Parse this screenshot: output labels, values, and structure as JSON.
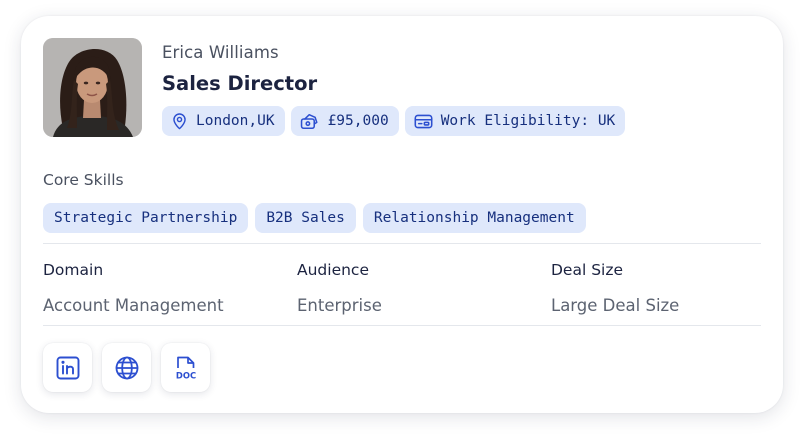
{
  "profile": {
    "name": "Erica Williams",
    "title": "Sales Director",
    "avatar_alt": "profile photo"
  },
  "chips": [
    {
      "icon": "location-pin-icon",
      "label": "London,UK"
    },
    {
      "icon": "salary-icon",
      "label": "£95,000"
    },
    {
      "icon": "id-card-icon",
      "label": "Work Eligibility: UK"
    }
  ],
  "skills": {
    "label": "Core Skills",
    "items": [
      "Strategic Partnership",
      "B2B Sales",
      "Relationship Management"
    ]
  },
  "details": [
    {
      "header": "Domain",
      "value": "Account Management"
    },
    {
      "header": "Audience",
      "value": "Enterprise"
    },
    {
      "header": "Deal Size",
      "value": "Large Deal Size"
    }
  ],
  "links": [
    {
      "icon": "linkedin-icon"
    },
    {
      "icon": "globe-icon"
    },
    {
      "icon": "doc-icon",
      "label": "DOC"
    }
  ],
  "colors": {
    "accent": "#2c4fd0",
    "chip_bg": "#dfe8fb",
    "chip_text": "#17307e",
    "title_text": "#1c2340"
  }
}
